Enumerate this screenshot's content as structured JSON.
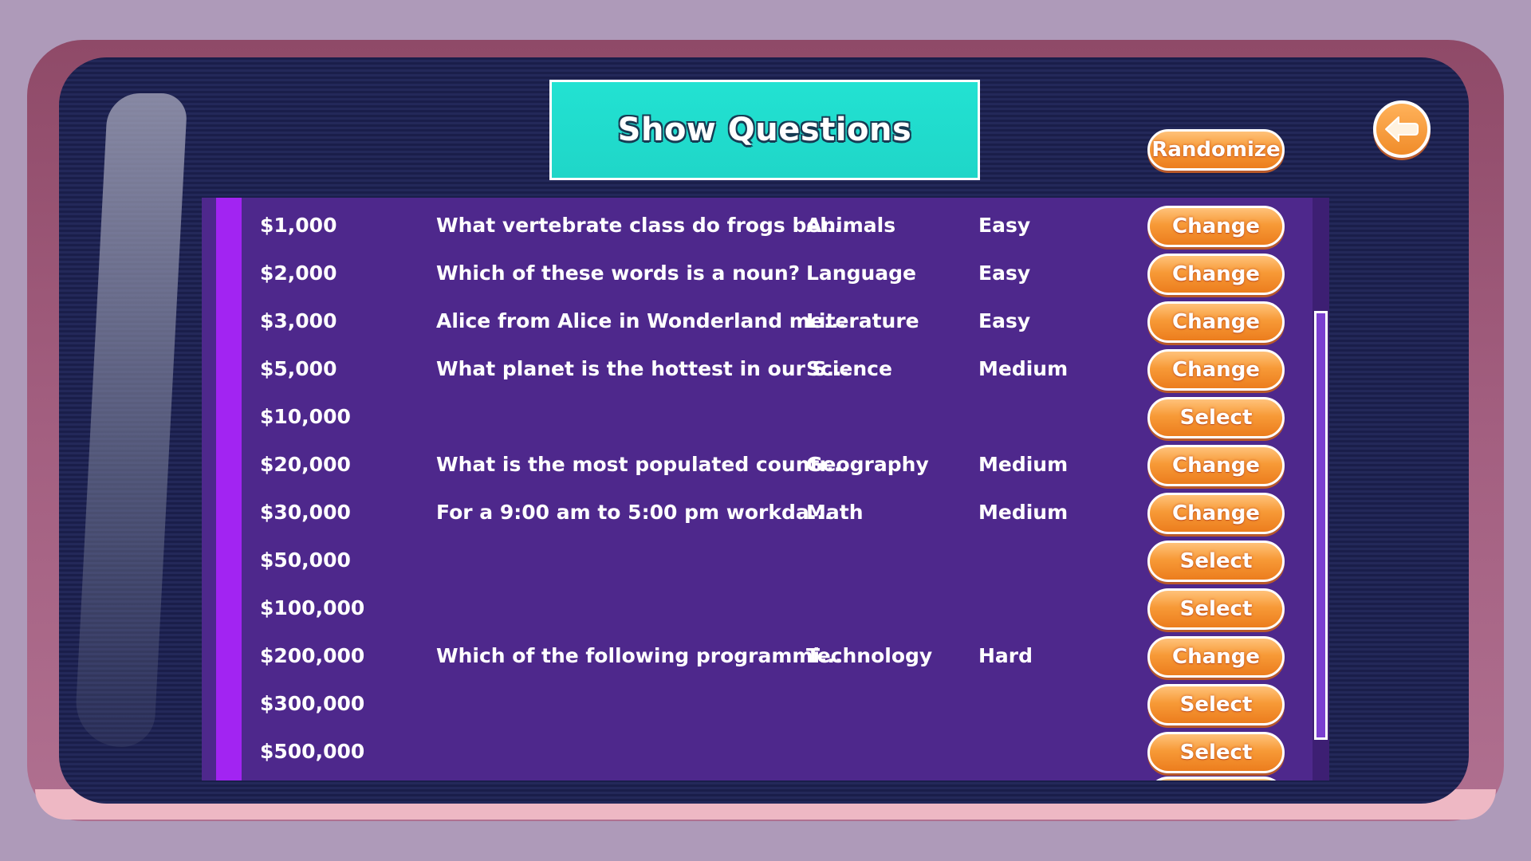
{
  "title": "Show Questions",
  "randomize_label": "Randomize",
  "back_icon": "arrow-left-icon",
  "colors": {
    "title_bg": "#22e2d2",
    "panel_bg": "#4e288c",
    "button_orange": "#f79a37",
    "screen_bg": "#1a1e4a"
  },
  "rows": [
    {
      "prize": "$1,000",
      "question": "What vertebrate class do frogs bel...",
      "category": "Animals",
      "difficulty": "Easy",
      "action": "Change"
    },
    {
      "prize": "$2,000",
      "question": "Which of these words is a noun?",
      "category": "Language",
      "difficulty": "Easy",
      "action": "Change"
    },
    {
      "prize": "$3,000",
      "question": "Alice from Alice in Wonderland me...",
      "category": "Literature",
      "difficulty": "Easy",
      "action": "Change"
    },
    {
      "prize": "$5,000",
      "question": "What planet is the hottest in our S...",
      "category": "Science",
      "difficulty": "Medium",
      "action": "Change"
    },
    {
      "prize": "$10,000",
      "question": "",
      "category": "",
      "difficulty": "",
      "action": "Select"
    },
    {
      "prize": "$20,000",
      "question": "What is the most populated countr...",
      "category": "Geography",
      "difficulty": "Medium",
      "action": "Change"
    },
    {
      "prize": "$30,000",
      "question": "For a 9:00 am to 5:00 pm workda...",
      "category": "Math",
      "difficulty": "Medium",
      "action": "Change"
    },
    {
      "prize": "$50,000",
      "question": "",
      "category": "",
      "difficulty": "",
      "action": "Select"
    },
    {
      "prize": "$100,000",
      "question": "",
      "category": "",
      "difficulty": "",
      "action": "Select"
    },
    {
      "prize": "$200,000",
      "question": "Which of the following programmi...",
      "category": "Technology",
      "difficulty": "Hard",
      "action": "Change"
    },
    {
      "prize": "$300,000",
      "question": "",
      "category": "",
      "difficulty": "",
      "action": "Select"
    },
    {
      "prize": "$500,000",
      "question": "",
      "category": "",
      "difficulty": "",
      "action": "Select"
    }
  ]
}
